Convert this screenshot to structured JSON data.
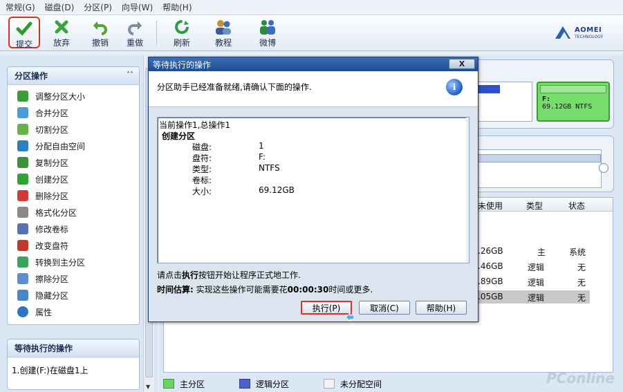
{
  "menu": [
    "常规(G)",
    "磁盘(D)",
    "分区(P)",
    "向导(W)",
    "帮助(H)"
  ],
  "toolbar": {
    "commit": "提交",
    "discard": "放弃",
    "undo": "撤销",
    "redo": "重做",
    "refresh": "刷新",
    "tutorial": "教程",
    "weibo": "微博"
  },
  "logo": {
    "name": "AOMEI",
    "sub": "TECHNOLOGY"
  },
  "left": {
    "ops_title": "分区操作",
    "ops": [
      {
        "label": "调整分区大小",
        "color": "#3a9d3a"
      },
      {
        "label": "合并分区",
        "color": "#4e9bd6"
      },
      {
        "label": "切割分区",
        "color": "#6ab04c"
      },
      {
        "label": "分配自由空间",
        "color": "#2d7fc1"
      },
      {
        "label": "复制分区",
        "color": "#3f8f3f"
      },
      {
        "label": "创建分区",
        "color": "#33a133"
      },
      {
        "label": "删除分区",
        "color": "#d03a3a"
      },
      {
        "label": "格式化分区",
        "color": "#8a8a8a"
      },
      {
        "label": "修改卷标",
        "color": "#5a6fb5"
      },
      {
        "label": "改变盘符",
        "color": "#c0392b"
      },
      {
        "label": "转换到主分区",
        "color": "#3aa35f"
      },
      {
        "label": "擦除分区",
        "color": "#5d8fd0"
      },
      {
        "label": "隐藏分区",
        "color": "#4a86c5"
      },
      {
        "label": "属性",
        "color": "#2f74c0"
      }
    ],
    "pending_title": "等待执行的操作",
    "pending_item": "1.创建(F:)在磁盘1上"
  },
  "disk": {
    "f_label": "F:",
    "f_size": "69.12GB NTFS"
  },
  "table": {
    "headers": [
      "未使用",
      "类型",
      "状态"
    ],
    "rows": [
      {
        "unused": ".26GB",
        "type": "主",
        "status": "系统"
      },
      {
        "unused": ".46GB",
        "type": "逻辑",
        "status": "无"
      },
      {
        "unused": ".89GB",
        "type": "逻辑",
        "status": "无"
      },
      {
        "unused": ".05GB",
        "type": "逻辑",
        "status": "无"
      }
    ]
  },
  "legend": {
    "primary": "主分区",
    "logical": "逻辑分区",
    "unallocated": "未分配空间"
  },
  "watermark": "PConline",
  "dialog": {
    "title": "等待执行的操作",
    "close": "X",
    "message": "分区助手已经准备就绪,请确认下面的操作.",
    "line1": "当前操作1,总操作1",
    "op_title": "创建分区",
    "fields": [
      {
        "k": "磁盘:",
        "v": "1"
      },
      {
        "k": "盘符:",
        "v": "F:"
      },
      {
        "k": "类型:",
        "v": "NTFS"
      },
      {
        "k": "卷标:",
        "v": ""
      },
      {
        "k": "大小:",
        "v": "69.12GB"
      }
    ],
    "hint1_pre": "请点击",
    "hint1_bold": "执行",
    "hint1_post": "按钮开始让程序正式地工作.",
    "hint2_bold1": "时间估算:",
    "hint2_mid": " 实现这些操作可能需要花",
    "hint2_time": "00:00:30",
    "hint2_post": "时间或更多.",
    "btn_execute": "执行(P)",
    "btn_cancel": "取消(C)",
    "btn_help": "帮助(H)"
  }
}
